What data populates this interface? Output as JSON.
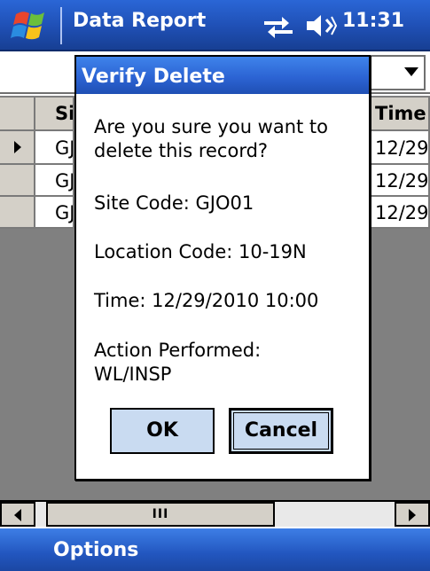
{
  "titlebar": {
    "app_title": "Data Report",
    "clock": "11:31",
    "color": "#1f4fb4"
  },
  "icons": {
    "start": "windows-flag-icon",
    "connectivity": "sync-arrows-icon",
    "volume": "speaker-icon"
  },
  "grid": {
    "headers": [
      "Sit",
      "Time"
    ],
    "rows": [
      {
        "site": "GJ",
        "time": "12/29",
        "selected": true
      },
      {
        "site": "GJ",
        "time": "12/29",
        "selected": false
      },
      {
        "site": "GJ",
        "time": "12/29",
        "selected": false
      }
    ]
  },
  "hscroll": {
    "thumb_grip": "III"
  },
  "menubar": {
    "options_label": "Options"
  },
  "dialog": {
    "title": "Verify Delete",
    "question_line1": "Are you sure you want to",
    "question_line2": "delete this record?",
    "site_code": "Site Code: GJO01",
    "location_code": "Location Code: 10-19N",
    "time": "Time: 12/29/2010 10:00",
    "action_line1": "Action Performed:",
    "action_line2": "WL/INSP",
    "ok_label": "OK",
    "cancel_label": "Cancel"
  }
}
